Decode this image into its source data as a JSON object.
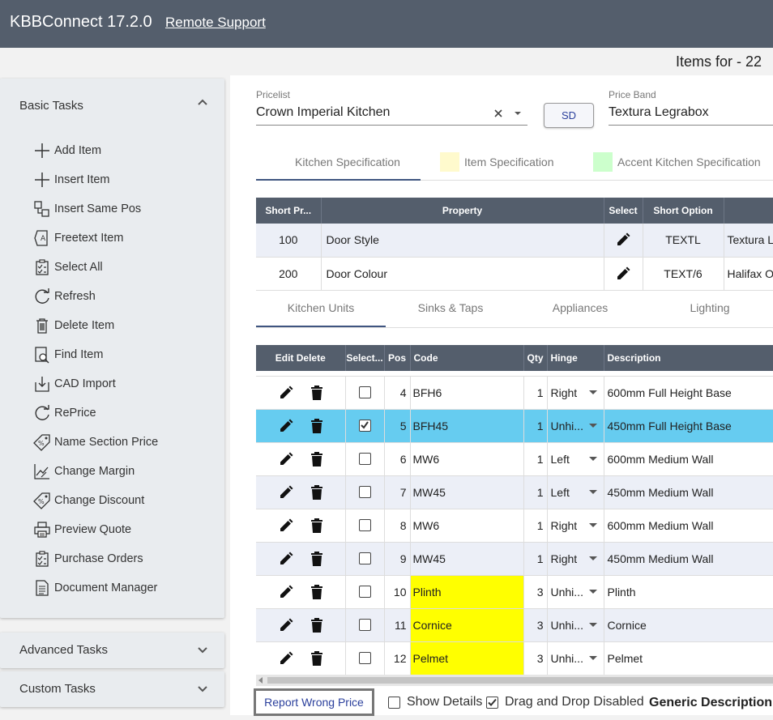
{
  "header": {
    "title": "KBBConnect 17.2.0",
    "remote_support": "Remote Support"
  },
  "page_heading": "Items for - 22",
  "sidebar": {
    "basic_title": "Basic Tasks",
    "tasks": [
      {
        "label": "Add Item",
        "icon": "plus-icon"
      },
      {
        "label": "Insert Item",
        "icon": "plus-icon"
      },
      {
        "label": "Insert Same Pos",
        "icon": "insert-same-pos-icon"
      },
      {
        "label": "Freetext Item",
        "icon": "freetext-icon"
      },
      {
        "label": "Select All",
        "icon": "checklist-icon"
      },
      {
        "label": "Refresh",
        "icon": "refresh-icon"
      },
      {
        "label": "Delete Item",
        "icon": "trash-icon"
      },
      {
        "label": "Find Item",
        "icon": "find-icon"
      },
      {
        "label": "CAD Import",
        "icon": "import-icon"
      },
      {
        "label": "RePrice",
        "icon": "refresh-icon"
      },
      {
        "label": "Name Section Price",
        "icon": "price-tag-icon"
      },
      {
        "label": "Change Margin",
        "icon": "margin-icon"
      },
      {
        "label": "Change Discount",
        "icon": "discount-icon"
      },
      {
        "label": "Preview Quote",
        "icon": "printer-icon"
      },
      {
        "label": "Purchase Orders",
        "icon": "checklist-icon"
      },
      {
        "label": "Document Manager",
        "icon": "document-icon"
      }
    ],
    "advanced_title": "Advanced Tasks",
    "custom_title": "Custom Tasks"
  },
  "pricelist": {
    "label": "Pricelist",
    "value": "Crown Imperial Kitchen"
  },
  "sd_button": "SD",
  "price_band": {
    "label": "Price Band",
    "value": "Textura Legrabox"
  },
  "spec_tabs": [
    {
      "label": "Kitchen Specification",
      "swatch": ""
    },
    {
      "label": "Item Specification",
      "swatch": "#fffacd"
    },
    {
      "label": "Accent Kitchen Specification",
      "swatch": "#ccffcc"
    }
  ],
  "spec_table": {
    "headers": [
      "Short Pr...",
      "Property",
      "Select",
      "Short Option",
      ""
    ],
    "rows": [
      {
        "short": "100",
        "property": "Door Style",
        "option": "TEXTL",
        "desc": "Textura L"
      },
      {
        "short": "200",
        "property": "Door Colour",
        "option": "TEXT/6",
        "desc": "Halifax O"
      }
    ]
  },
  "unit_tabs": [
    "Kitchen Units",
    "Sinks & Taps",
    "Appliances",
    "Lighting"
  ],
  "items_table": {
    "headers": [
      "Edit Delete",
      "Select...",
      "Pos",
      "Code",
      "Qty",
      "Hinge",
      "Description"
    ],
    "rows": [
      {
        "pos": "4",
        "code": "BFH6",
        "qty": "1",
        "hinge": "Right",
        "desc": "600mm Full Height Base",
        "checked": false,
        "highlight": false
      },
      {
        "pos": "5",
        "code": "BFH45",
        "qty": "1",
        "hinge": "Unhi...",
        "desc": "450mm Full Height Base",
        "checked": true,
        "highlight": false
      },
      {
        "pos": "6",
        "code": "MW6",
        "qty": "1",
        "hinge": "Left",
        "desc": "600mm Medium Wall",
        "checked": false,
        "highlight": false
      },
      {
        "pos": "7",
        "code": "MW45",
        "qty": "1",
        "hinge": "Left",
        "desc": "450mm Medium Wall",
        "checked": false,
        "highlight": false
      },
      {
        "pos": "8",
        "code": "MW6",
        "qty": "1",
        "hinge": "Right",
        "desc": "600mm Medium Wall",
        "checked": false,
        "highlight": false
      },
      {
        "pos": "9",
        "code": "MW45",
        "qty": "1",
        "hinge": "Right",
        "desc": "450mm Medium Wall",
        "checked": false,
        "highlight": false
      },
      {
        "pos": "10",
        "code": "Plinth",
        "qty": "3",
        "hinge": "Unhi...",
        "desc": "Plinth",
        "checked": false,
        "highlight": true
      },
      {
        "pos": "11",
        "code": "Cornice",
        "qty": "3",
        "hinge": "Unhi...",
        "desc": "Cornice",
        "checked": false,
        "highlight": true
      },
      {
        "pos": "12",
        "code": "Pelmet",
        "qty": "3",
        "hinge": "Unhi...",
        "desc": "Pelmet",
        "checked": false,
        "highlight": true
      }
    ]
  },
  "footer": {
    "report_button": "Report Wrong Price",
    "show_details": "Show Details",
    "drag_drop": "Drag and Drop Disabled",
    "generic_description": "Generic Description:"
  },
  "colors": {
    "header": "#545e6c",
    "selected_row": "#66ccf0",
    "highlight": "#ffff00"
  }
}
